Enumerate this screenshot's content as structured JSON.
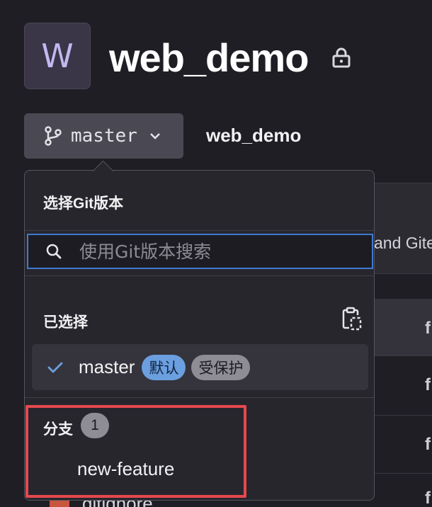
{
  "project": {
    "avatar_letter": "W",
    "title": "web_demo",
    "breadcrumb": "web_demo"
  },
  "branch_selector": {
    "current": "master"
  },
  "dropdown": {
    "title": "选择Git版本",
    "search_placeholder": "使用Git版本搜索",
    "selected_section": {
      "title": "已选择",
      "item": {
        "name": "master",
        "badges": [
          "默认",
          "受保护"
        ]
      }
    },
    "branches_section": {
      "title": "分支",
      "count": "1",
      "items": [
        "new-feature"
      ]
    }
  },
  "background": {
    "partial_text": "and Gite",
    "partial_file": "gitignore",
    "column_letters": [
      "f",
      "f",
      "f",
      "f"
    ]
  },
  "colors": {
    "accent_focus": "#3f7bd0",
    "highlight": "#e6484e"
  }
}
